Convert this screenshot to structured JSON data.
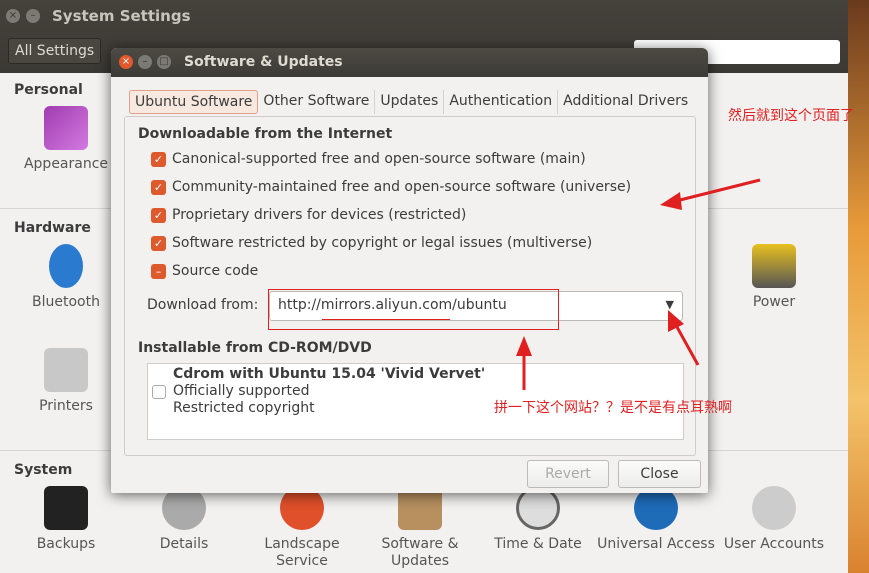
{
  "settings": {
    "title": "System Settings",
    "all_settings": "All Settings",
    "sections": {
      "personal": "Personal",
      "hardware": "Hardware",
      "system": "System"
    },
    "personal": [
      {
        "label": "Appearance"
      }
    ],
    "hardware": [
      {
        "label": "Bluetooth"
      },
      {
        "label": "Printers"
      },
      {
        "label": "Power"
      }
    ],
    "system": [
      {
        "label": "Backups"
      },
      {
        "label": "Details"
      },
      {
        "label": "Landscape Service"
      },
      {
        "label": "Software & Updates"
      },
      {
        "label": "Time & Date"
      },
      {
        "label": "Universal Access"
      },
      {
        "label": "User Accounts"
      }
    ]
  },
  "dialog": {
    "title": "Software & Updates",
    "tabs": [
      "Ubuntu Software",
      "Other Software",
      "Updates",
      "Authentication",
      "Additional Drivers"
    ],
    "downloadable_heading": "Downloadable from the Internet",
    "options": [
      {
        "label": "Canonical-supported free and open-source software (main)",
        "state": "checked"
      },
      {
        "label": "Community-maintained free and open-source software (universe)",
        "state": "checked"
      },
      {
        "label": "Proprietary drivers for devices (restricted)",
        "state": "checked"
      },
      {
        "label": "Software restricted by copyright or legal issues (multiverse)",
        "state": "checked"
      },
      {
        "label": "Source code",
        "state": "mixed"
      }
    ],
    "download_from_label": "Download from:",
    "download_from_value": "http://mirrors.aliyun.com/ubuntu",
    "cdrom_heading": "Installable from CD-ROM/DVD",
    "cdrom": {
      "title": "Cdrom with Ubuntu 15.04 'Vivid Vervet'",
      "line1": "Officially supported",
      "line2": "Restricted copyright",
      "checked": false
    },
    "revert": "Revert",
    "close": "Close"
  },
  "annotations": {
    "note1": "然后就到这个页面了",
    "note2": "拼一下这个网站？？是不是有点耳熟啊",
    "color": "#e02020"
  }
}
